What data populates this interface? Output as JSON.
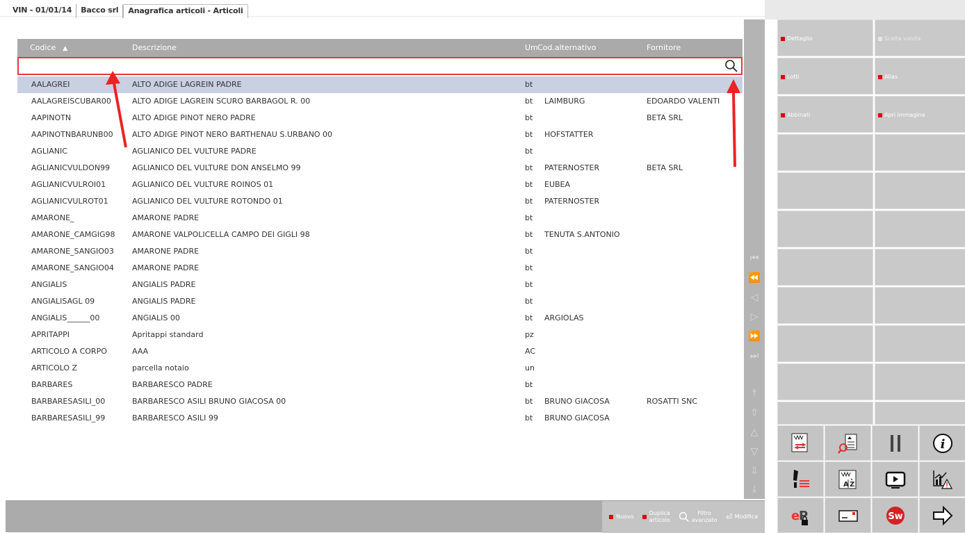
{
  "topbar": {
    "tabs": [
      "VIN - 01/01/14",
      "Bacco srl",
      "Anagrafica articoli - Articoli"
    ]
  },
  "table": {
    "headers": {
      "codice": "Codice",
      "descrizione": "Descrizione",
      "um": "Um",
      "alt": "Cod.alternativo",
      "fornitore": "Fornitore"
    },
    "sort_indicator": "▲",
    "rows": [
      {
        "codice": "AALAGREI",
        "desc": "ALTO ADIGE LAGREIN PADRE",
        "um": "bt",
        "alt": "",
        "forn": ""
      },
      {
        "codice": "AALAGREISCUBAR00",
        "desc": "ALTO ADIGE LAGREIN SCURO BARBAGOL R. 00",
        "um": "bt",
        "alt": "LAIMBURG",
        "forn": "EDOARDO VALENTI"
      },
      {
        "codice": "AAPINOTN",
        "desc": "ALTO ADIGE PINOT NERO PADRE",
        "um": "bt",
        "alt": "",
        "forn": "BETA SRL"
      },
      {
        "codice": "AAPINOTNBARUNB00",
        "desc": "ALTO ADIGE PINOT NERO BARTHENAU S.URBANO 00",
        "um": "bt",
        "alt": "HOFSTATTER",
        "forn": ""
      },
      {
        "codice": "AGLIANIC",
        "desc": "AGLIANICO DEL VULTURE  PADRE",
        "um": "bt",
        "alt": "",
        "forn": ""
      },
      {
        "codice": "AGLIANICVULDON99",
        "desc": "AGLIANICO DEL VULTURE DON ANSELMO 99",
        "um": "bt",
        "alt": "PATERNOSTER",
        "forn": "BETA SRL"
      },
      {
        "codice": "AGLIANICVULROI01",
        "desc": "AGLIANICO DEL VULTURE ROINOS 01",
        "um": "bt",
        "alt": "EUBEA",
        "forn": ""
      },
      {
        "codice": "AGLIANICVULROT01",
        "desc": "AGLIANICO DEL VULTURE ROTONDO 01",
        "um": "bt",
        "alt": "PATERNOSTER",
        "forn": ""
      },
      {
        "codice": "AMARONE_",
        "desc": "AMARONE PADRE",
        "um": "bt",
        "alt": "",
        "forn": ""
      },
      {
        "codice": "AMARONE_CAMGIG98",
        "desc": "AMARONE VALPOLICELLA CAMPO DEI GIGLI 98",
        "um": "bt",
        "alt": "TENUTA S.ANTONIO",
        "forn": ""
      },
      {
        "codice": "AMARONE_SANGIO03",
        "desc": "AMARONE PADRE",
        "um": "bt",
        "alt": "",
        "forn": ""
      },
      {
        "codice": "AMARONE_SANGIO04",
        "desc": "AMARONE PADRE",
        "um": "bt",
        "alt": "",
        "forn": ""
      },
      {
        "codice": "ANGIALIS",
        "desc": "ANGIALIS PADRE",
        "um": "bt",
        "alt": "",
        "forn": ""
      },
      {
        "codice": "ANGIALISAGL  09",
        "desc": "ANGIALIS PADRE",
        "um": "bt",
        "alt": "",
        "forn": ""
      },
      {
        "codice": "ANGIALIS______00",
        "desc": "ANGIALIS 00",
        "um": "bt",
        "alt": "ARGIOLAS",
        "forn": ""
      },
      {
        "codice": "APRITAPPI",
        "desc": "Apritappi standard",
        "um": "pz",
        "alt": "",
        "forn": ""
      },
      {
        "codice": "ARTICOLO A CORPO",
        "desc": "AAA",
        "um": "AC",
        "alt": "",
        "forn": ""
      },
      {
        "codice": "ARTICOLO Z",
        "desc": "parcella notaio",
        "um": "un",
        "alt": "",
        "forn": ""
      },
      {
        "codice": "BARBARES",
        "desc": "BARBARESCO PADRE",
        "um": "bt",
        "alt": "",
        "forn": ""
      },
      {
        "codice": "BARBARESASILI_00",
        "desc": "BARBARESCO ASILI BRUNO GIACOSA 00",
        "um": "bt",
        "alt": "BRUNO GIACOSA",
        "forn": "ROSATTI SNC"
      },
      {
        "codice": "BARBARESASILI_99",
        "desc": "BARBARESCO ASILI 99",
        "um": "bt",
        "alt": "BRUNO GIACOSA",
        "forn": ""
      }
    ]
  },
  "footer": {
    "nuovo": "Nuovo",
    "duplica_1": "Duplica",
    "duplica_2": "articolo",
    "filtro_1": "Filtro",
    "filtro_2": "avanzato",
    "modifica": "Modifica"
  },
  "side_panel": {
    "dettaglio": "Dettaglio",
    "scelta_valuta": "Scelta valuta",
    "lotti": "Lotti",
    "alias": "Alias",
    "abbinati": "Abbinati",
    "apri_immagine": "Apri immagine"
  },
  "icons": [
    "export-icon",
    "search-document-icon",
    "pause-icon",
    "info-icon",
    "edit-list-icon",
    "sort-az-icon",
    "play-video-icon",
    "chart-warning-icon",
    "ep-lock-icon",
    "card-icon",
    "sw-logo-icon",
    "arrow-right-icon"
  ],
  "colors": {
    "selection": "#c9d0e2",
    "header": "#aaaaaa",
    "accent_red": "#e00000",
    "annotation_red": "#e22222"
  }
}
